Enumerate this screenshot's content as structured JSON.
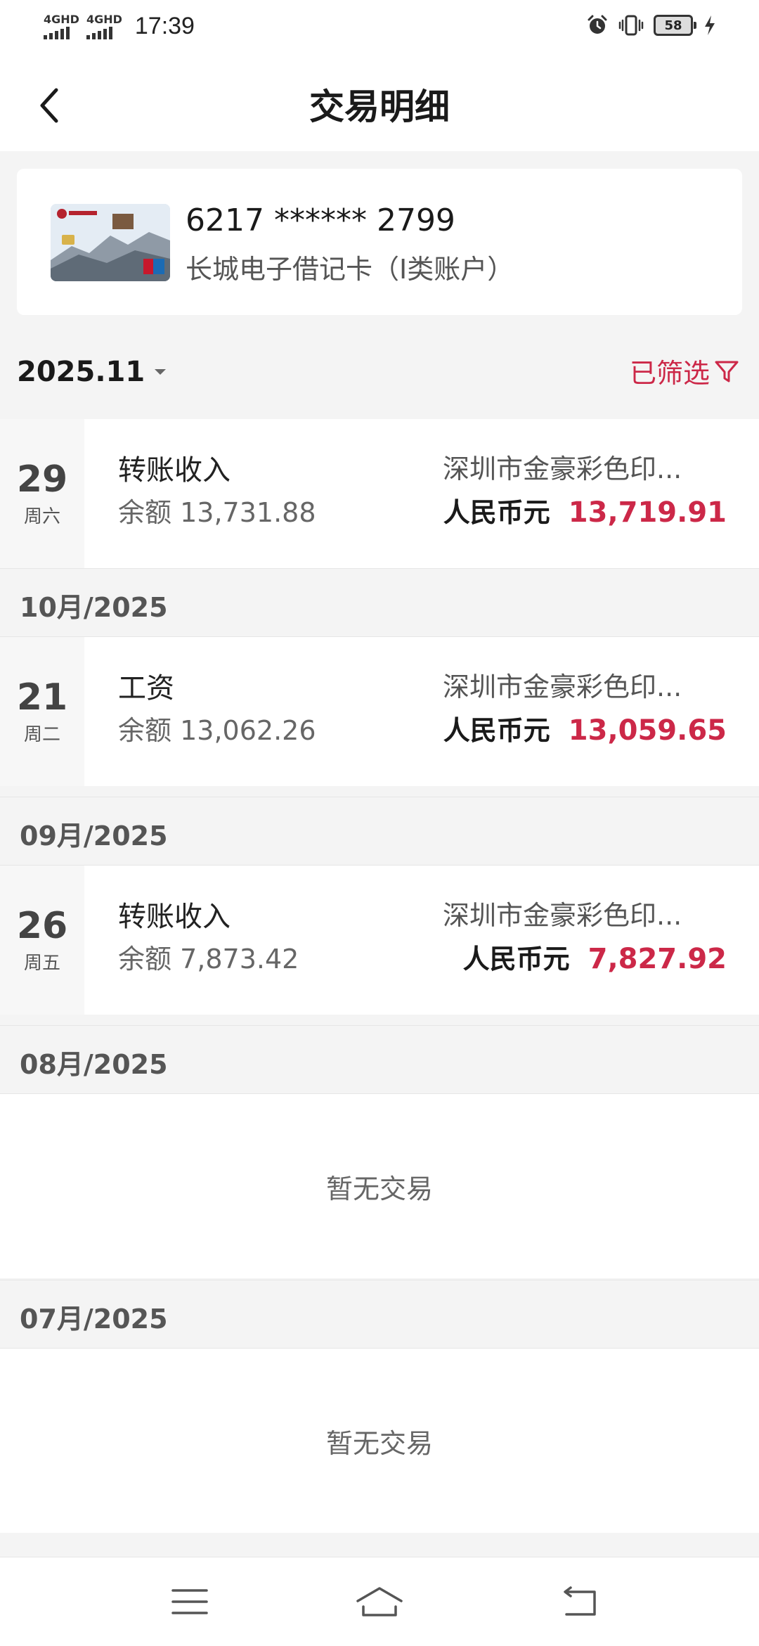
{
  "status_bar": {
    "sim1": "4GHD",
    "sim2": "4GHD",
    "time": "17:39",
    "battery": "58",
    "icons": [
      "alarm-icon",
      "vibrate-icon",
      "battery-icon",
      "charging-icon"
    ]
  },
  "header": {
    "title": "交易明细",
    "back_icon": "back-arrow-icon"
  },
  "card": {
    "number": "6217 ****** 2799",
    "type": "长城电子借记卡（I类账户）"
  },
  "filter": {
    "month": "2025.11",
    "filtered_label": "已筛选"
  },
  "sections": [
    {
      "transactions": [
        {
          "day": "29",
          "weekday": "周六",
          "type": "转账收入",
          "balance_label": "余额",
          "balance": "13,731.88",
          "merchant": "深圳市金豪彩色印...",
          "currency": "人民币元",
          "amount": "13,719.91"
        }
      ]
    },
    {
      "month": "10月/2025",
      "transactions": [
        {
          "day": "21",
          "weekday": "周二",
          "type": "工资",
          "balance_label": "余额",
          "balance": "13,062.26",
          "merchant": "深圳市金豪彩色印...",
          "currency": "人民币元",
          "amount": "13,059.65"
        }
      ]
    },
    {
      "month": "09月/2025",
      "transactions": [
        {
          "day": "26",
          "weekday": "周五",
          "type": "转账收入",
          "balance_label": "余额",
          "balance": "7,873.42",
          "merchant": "深圳市金豪彩色印...",
          "currency": "人民币元",
          "amount": "7,827.92"
        }
      ]
    },
    {
      "month": "08月/2025",
      "empty_text": "暂无交易"
    },
    {
      "month": "07月/2025",
      "empty_text": "暂无交易"
    }
  ],
  "nav": {
    "icons": [
      "menu-icon",
      "home-icon",
      "back-icon"
    ]
  },
  "colors": {
    "accent": "#cc2848",
    "background": "#f4f4f4",
    "date_column": "#f7f7f7"
  }
}
